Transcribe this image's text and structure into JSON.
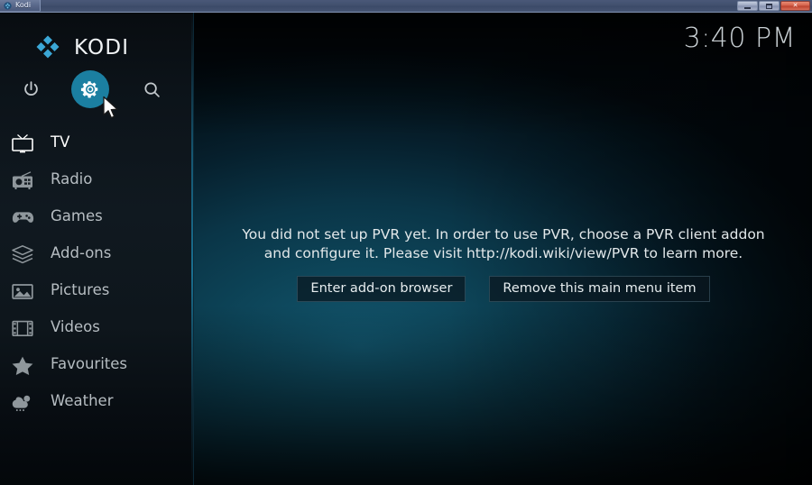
{
  "window": {
    "title": "Kodi",
    "icon": "kodi-logo-icon",
    "buttons": {
      "minimize": "minimize-button",
      "maximize": "restore-button",
      "close": "close-button",
      "close_glyph": "✕"
    }
  },
  "brand": {
    "name": "KODI",
    "logo": "kodi-diamond-logo"
  },
  "toolbar": {
    "items": [
      {
        "name": "power-icon",
        "label": "Power",
        "active": false
      },
      {
        "name": "gear-icon",
        "label": "Settings",
        "active": true
      },
      {
        "name": "search-icon",
        "label": "Search",
        "active": false
      }
    ],
    "active_color": "#1b7fa1"
  },
  "clock": {
    "time": "3:40 PM"
  },
  "sidebar": {
    "items": [
      {
        "label": "TV",
        "icon": "tv-icon",
        "selected": true
      },
      {
        "label": "Radio",
        "icon": "radio-icon",
        "selected": false
      },
      {
        "label": "Games",
        "icon": "gamepad-icon",
        "selected": false
      },
      {
        "label": "Add-ons",
        "icon": "addons-box-icon",
        "selected": false
      },
      {
        "label": "Pictures",
        "icon": "pictures-icon",
        "selected": false
      },
      {
        "label": "Videos",
        "icon": "film-strip-icon",
        "selected": false
      },
      {
        "label": "Favourites",
        "icon": "star-icon",
        "selected": false
      },
      {
        "label": "Weather",
        "icon": "weather-cloud-sun-icon",
        "selected": false
      }
    ]
  },
  "main": {
    "notice": "You did not set up PVR yet. In order to use PVR, choose a PVR client addon and configure it. Please visit http://kodi.wiki/view/PVR to learn more.",
    "buttons": [
      {
        "label": "Enter add-on browser",
        "name": "enter-addon-browser-button"
      },
      {
        "label": "Remove this main menu item",
        "name": "remove-main-menu-item-button"
      }
    ]
  },
  "colors": {
    "accent": "#1b7fa1",
    "logo_blue": "#3ba7d6",
    "sidebar_bg": "#101920",
    "text_primary": "#ffffff",
    "text_muted": "#b6bdc2"
  }
}
